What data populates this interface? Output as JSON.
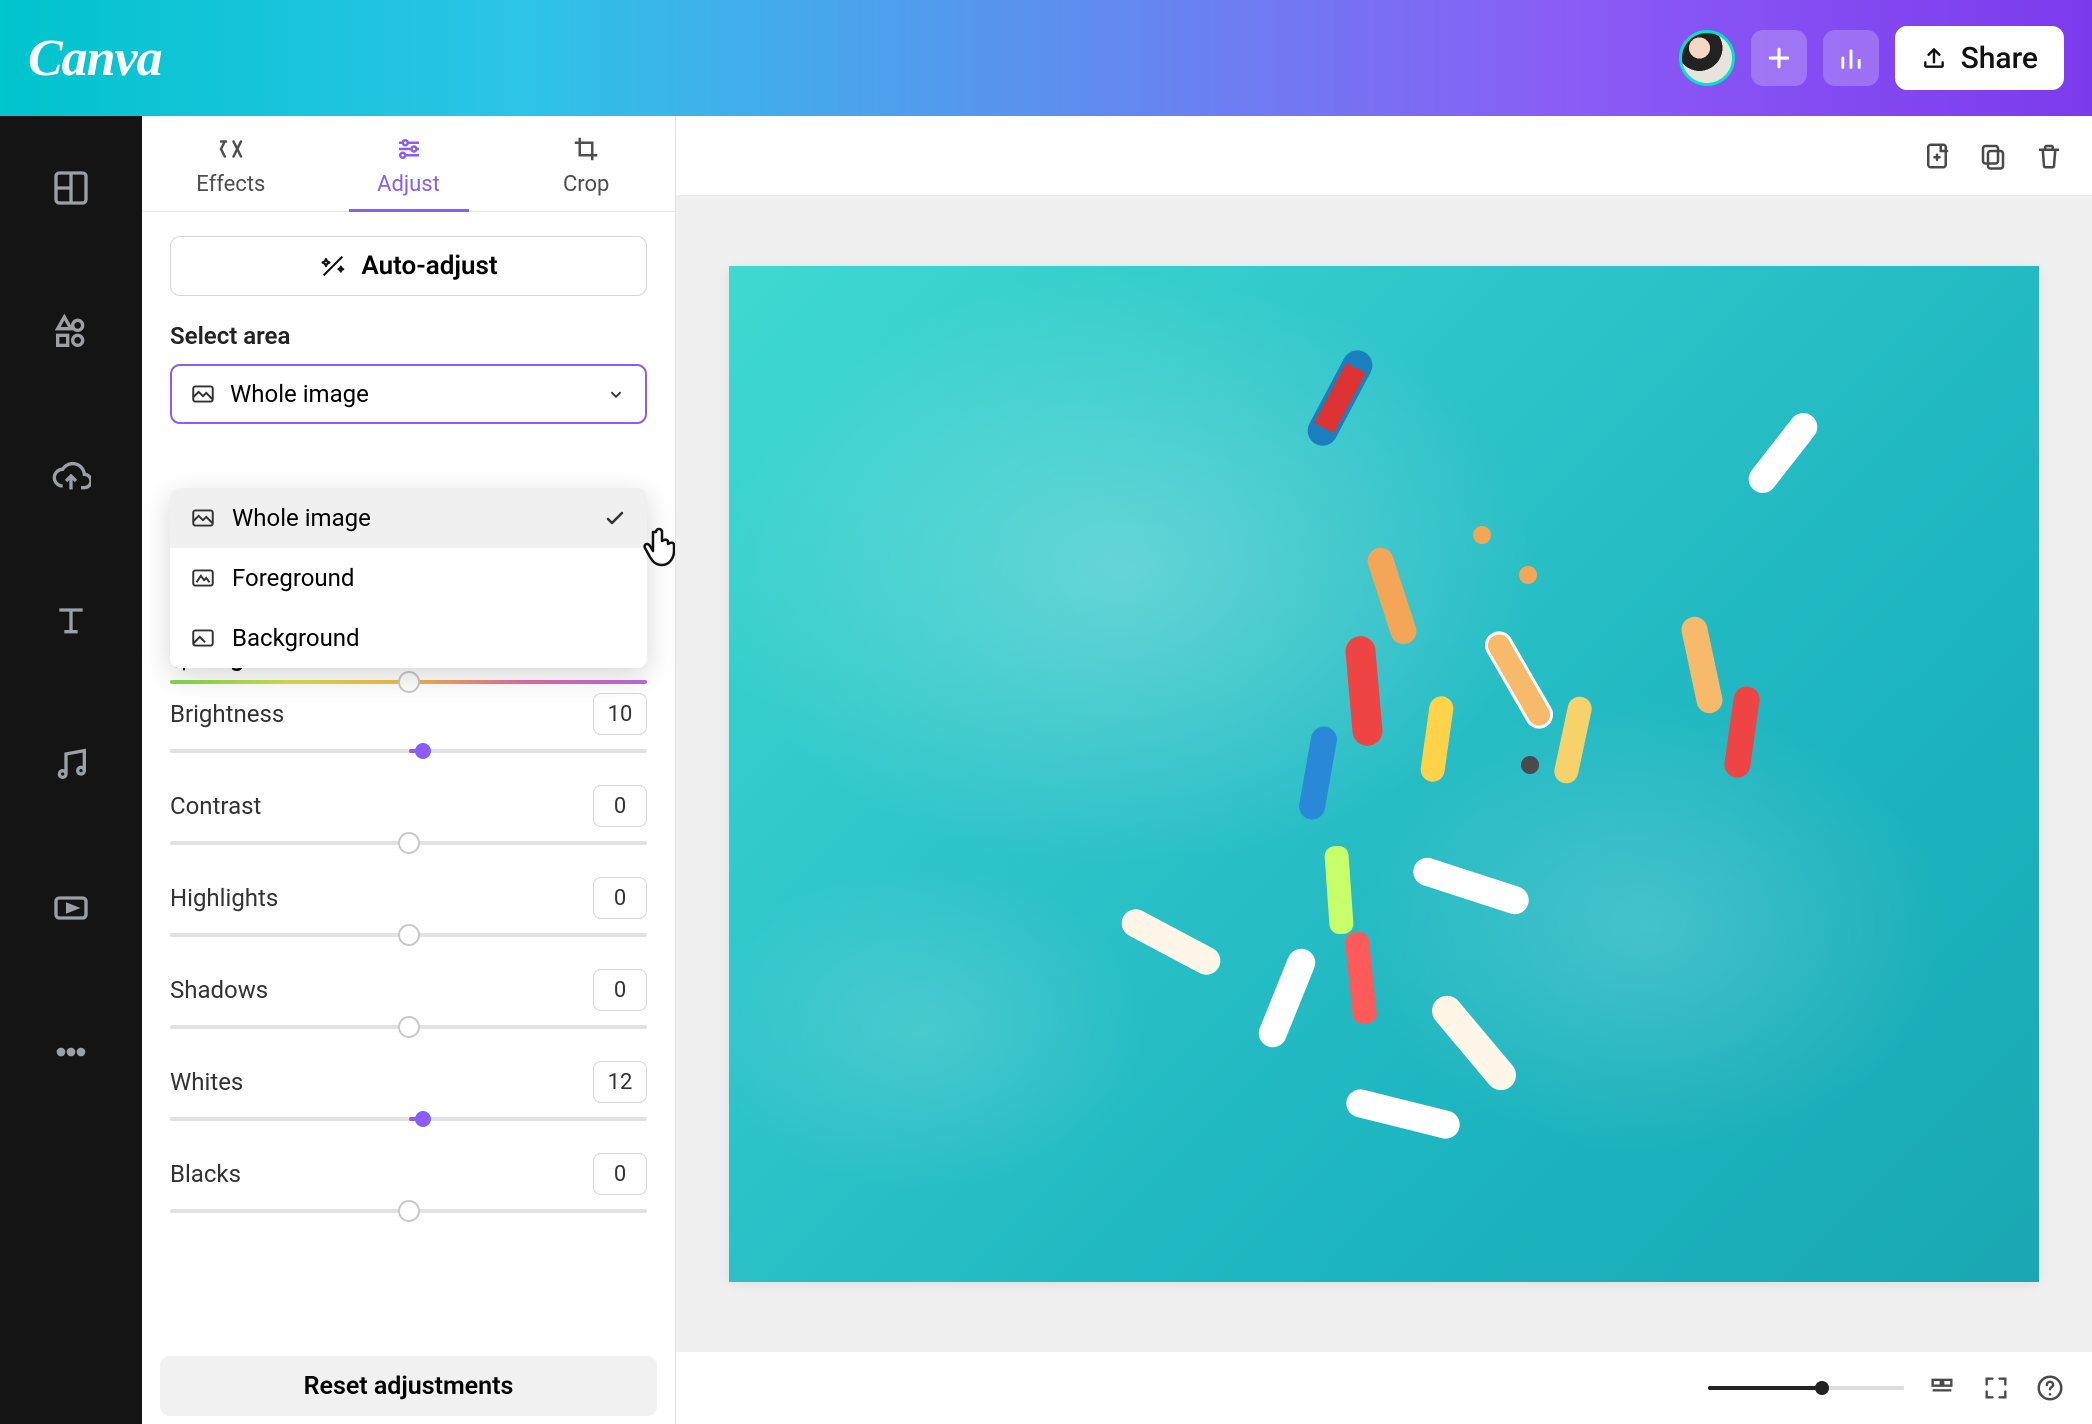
{
  "header": {
    "logo": "Canva",
    "share_label": "Share"
  },
  "tabs": {
    "effects": "Effects",
    "adjust": "Adjust",
    "crop": "Crop"
  },
  "panel": {
    "auto_adjust": "Auto-adjust",
    "select_area_label": "Select area",
    "select_value": "Whole image",
    "dropdown": {
      "whole_image": "Whole image",
      "foreground": "Foreground",
      "background": "Background"
    },
    "light_section": "Light",
    "sliders": {
      "brightness": {
        "label": "Brightness",
        "value": "10",
        "percent": 53
      },
      "contrast": {
        "label": "Contrast",
        "value": "0",
        "percent": 50
      },
      "highlights": {
        "label": "Highlights",
        "value": "0",
        "percent": 50
      },
      "shadows": {
        "label": "Shadows",
        "value": "0",
        "percent": 50
      },
      "whites": {
        "label": "Whites",
        "value": "12",
        "percent": 53
      },
      "blacks": {
        "label": "Blacks",
        "value": "0",
        "percent": 50
      }
    },
    "reset": "Reset adjustments"
  }
}
